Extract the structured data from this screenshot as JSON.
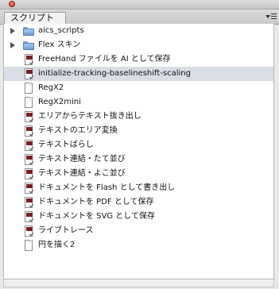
{
  "panel": {
    "tab_label": "スクリプト"
  },
  "items": [
    {
      "type": "folder",
      "label": "aics_scripts",
      "expandable": true,
      "selected": false,
      "icon": "folder-icon"
    },
    {
      "type": "folder",
      "label": "Flex スキン",
      "expandable": true,
      "selected": false,
      "icon": "folder-icon"
    },
    {
      "type": "script",
      "label": "FreeHand ファイルを AI として保存",
      "expandable": false,
      "selected": false,
      "icon": "script-icon"
    },
    {
      "type": "script",
      "label": "initialize-tracking-baselineshift-scaling",
      "expandable": false,
      "selected": true,
      "icon": "script-icon"
    },
    {
      "type": "doc",
      "label": "RegX2",
      "expandable": false,
      "selected": false,
      "icon": "document-icon"
    },
    {
      "type": "doc",
      "label": "RegX2mini",
      "expandable": false,
      "selected": false,
      "icon": "document-icon"
    },
    {
      "type": "script",
      "label": "エリアからテキスト抜き出し",
      "expandable": false,
      "selected": false,
      "icon": "script-icon"
    },
    {
      "type": "script",
      "label": "テキストのエリア変換",
      "expandable": false,
      "selected": false,
      "icon": "script-icon"
    },
    {
      "type": "script",
      "label": "テキストばらし",
      "expandable": false,
      "selected": false,
      "icon": "script-icon"
    },
    {
      "type": "script",
      "label": "テキスト連結・たて並び",
      "expandable": false,
      "selected": false,
      "icon": "script-icon"
    },
    {
      "type": "script",
      "label": "テキスト連結・よこ並び",
      "expandable": false,
      "selected": false,
      "icon": "script-icon"
    },
    {
      "type": "script",
      "label": "ドキュメントを Flash として書き出し",
      "expandable": false,
      "selected": false,
      "icon": "script-icon"
    },
    {
      "type": "script",
      "label": "ドキュメントを PDF として保存",
      "expandable": false,
      "selected": false,
      "icon": "script-icon"
    },
    {
      "type": "script",
      "label": "ドキュメントを SVG として保存",
      "expandable": false,
      "selected": false,
      "icon": "script-icon"
    },
    {
      "type": "script",
      "label": "ライブトレース",
      "expandable": false,
      "selected": false,
      "icon": "script-icon"
    },
    {
      "type": "doc",
      "label": "円を描く2",
      "expandable": false,
      "selected": false,
      "icon": "document-icon"
    }
  ],
  "colors": {
    "selection": "#d9dee6",
    "script_band": "#7a1f24",
    "folder": "#6f9fd6",
    "close_button": "#d63a2e"
  }
}
